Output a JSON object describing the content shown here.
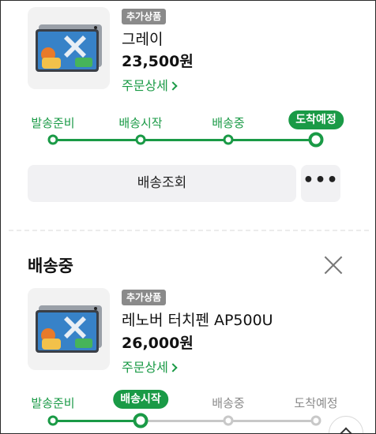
{
  "colors": {
    "accent": "#1a9a46",
    "inactive": "#c8c8c8",
    "badge": "#8a8a8a"
  },
  "order1": {
    "badge": "추가상품",
    "name": "그레이",
    "price": "23,500원",
    "detail_link": "주문상세",
    "thumbnail": "tablet-image",
    "steps": [
      "발송준비",
      "배송시작",
      "배송중",
      "도착예정"
    ],
    "current_step": "도착예정",
    "track_button": "배송조회",
    "more_button": "•••"
  },
  "order2": {
    "status_title": "배송중",
    "badge": "추가상품",
    "name": "레노버 터치펜 AP500U",
    "price": "26,000원",
    "detail_link": "주문상세",
    "thumbnail": "tablet-image",
    "steps": [
      "발송준비",
      "배송시작",
      "배송중",
      "도착예정"
    ],
    "current_step": "배송시작"
  },
  "scroll_top_icon": "chevron-up-icon"
}
